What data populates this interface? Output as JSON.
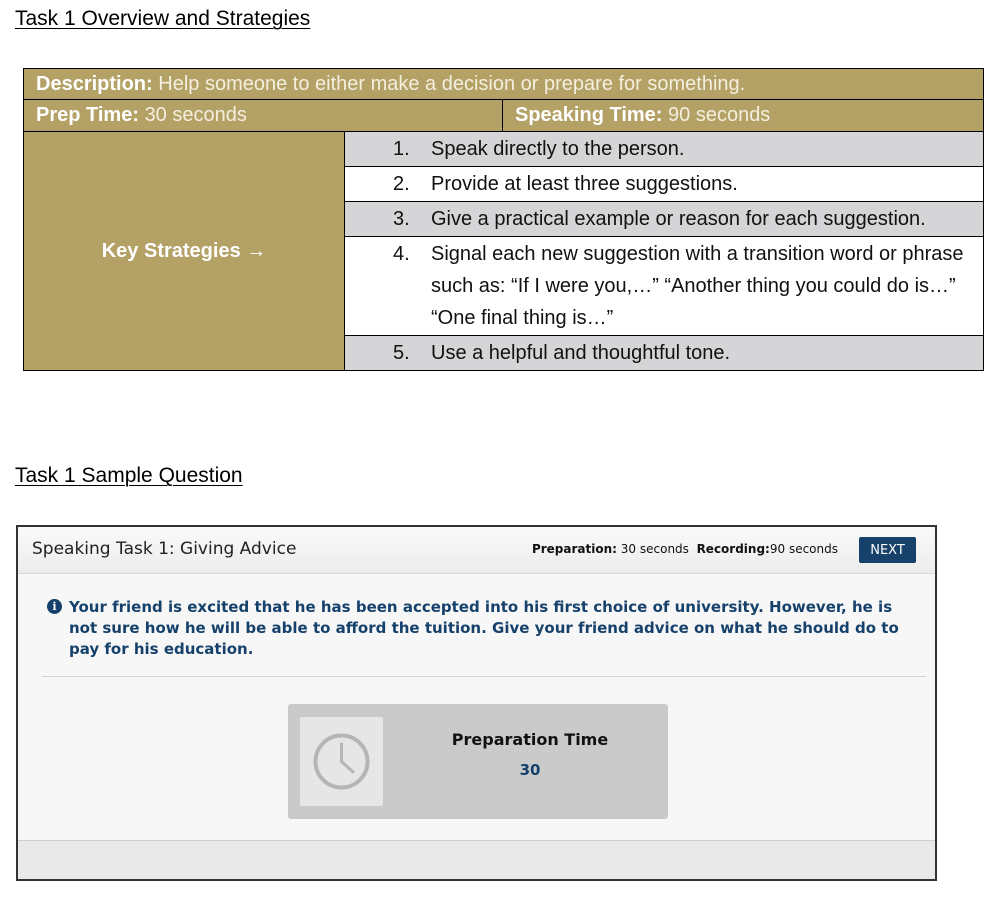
{
  "headings": {
    "overview": "Task 1 Overview and Strategies",
    "sample": "Task 1 Sample Question"
  },
  "table": {
    "description_label": "Description:",
    "description_value": "Help someone to either make a decision or prepare for something.",
    "prep_label": "Prep Time:",
    "prep_value": "30 seconds",
    "speak_label": "Speaking Time:",
    "speak_value": "90 seconds",
    "key_label": "Key Strategies →",
    "strategies": [
      {
        "num": "1.",
        "text": "Speak directly to the person."
      },
      {
        "num": "2.",
        "text": "Provide at least three suggestions."
      },
      {
        "num": "3.",
        "text": "Give a practical example or reason for each suggestion."
      },
      {
        "num": "4.",
        "text": "Signal each new suggestion with a transition word or phrase such as: “If I were you,…” “Another thing you could do is…” “One final thing is…”"
      },
      {
        "num": "5.",
        "text": "Use a helpful and thoughtful tone."
      }
    ]
  },
  "window": {
    "title": "Speaking Task 1: Giving Advice",
    "prep_label": "Preparation:",
    "prep_value": "30 seconds",
    "rec_label": "Recording:",
    "rec_value": "90 seconds",
    "next_label": "NEXT",
    "question": "Your friend is excited that he has been accepted into his first choice of university. However, he is not sure how he will be able to afford the tuition. Give your friend advice on what he should do to pay for his education.",
    "prep_box_label": "Preparation Time",
    "prep_box_count": "30"
  },
  "colors": {
    "gold": "#b3a166",
    "gray_row": "#d5d4d7",
    "navy": "#15416b"
  },
  "icons": {
    "info": "info-circle-icon",
    "clock": "clock-icon"
  }
}
